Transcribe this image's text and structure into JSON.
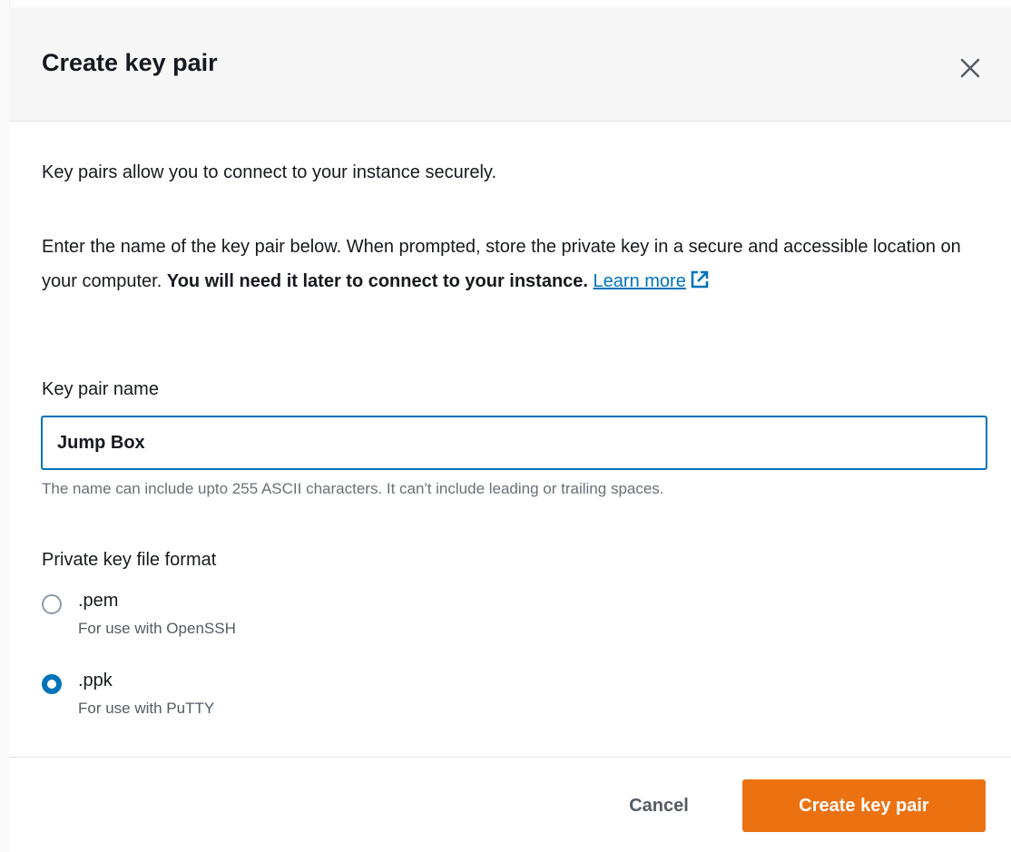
{
  "dialog": {
    "title": "Create key pair",
    "close_icon": "close-icon"
  },
  "intro": "Key pairs allow you to connect to your instance securely.",
  "instructions": {
    "text": "Enter the name of the key pair below. When prompted, store the private key in a secure and accessible location on your computer. ",
    "bold": "You will need it later to connect to your instance.",
    "link": "Learn more",
    "link_icon": "external-link-icon"
  },
  "key_name": {
    "label": "Key pair name",
    "value": "Jump Box",
    "constraint": "The name can include upto 255 ASCII characters. It can't include leading or trailing spaces."
  },
  "file_format": {
    "label": "Private key file format",
    "options": [
      {
        "label": ".pem",
        "description": "For use with OpenSSH",
        "selected": false
      },
      {
        "label": ".ppk",
        "description": "For use with PuTTY",
        "selected": true
      }
    ]
  },
  "footer": {
    "cancel_label": "Cancel",
    "create_label": "Create key pair"
  },
  "colors": {
    "accent": "#0073bb",
    "primary_button": "#ec7211",
    "header_bg": "#f7f7f7"
  }
}
